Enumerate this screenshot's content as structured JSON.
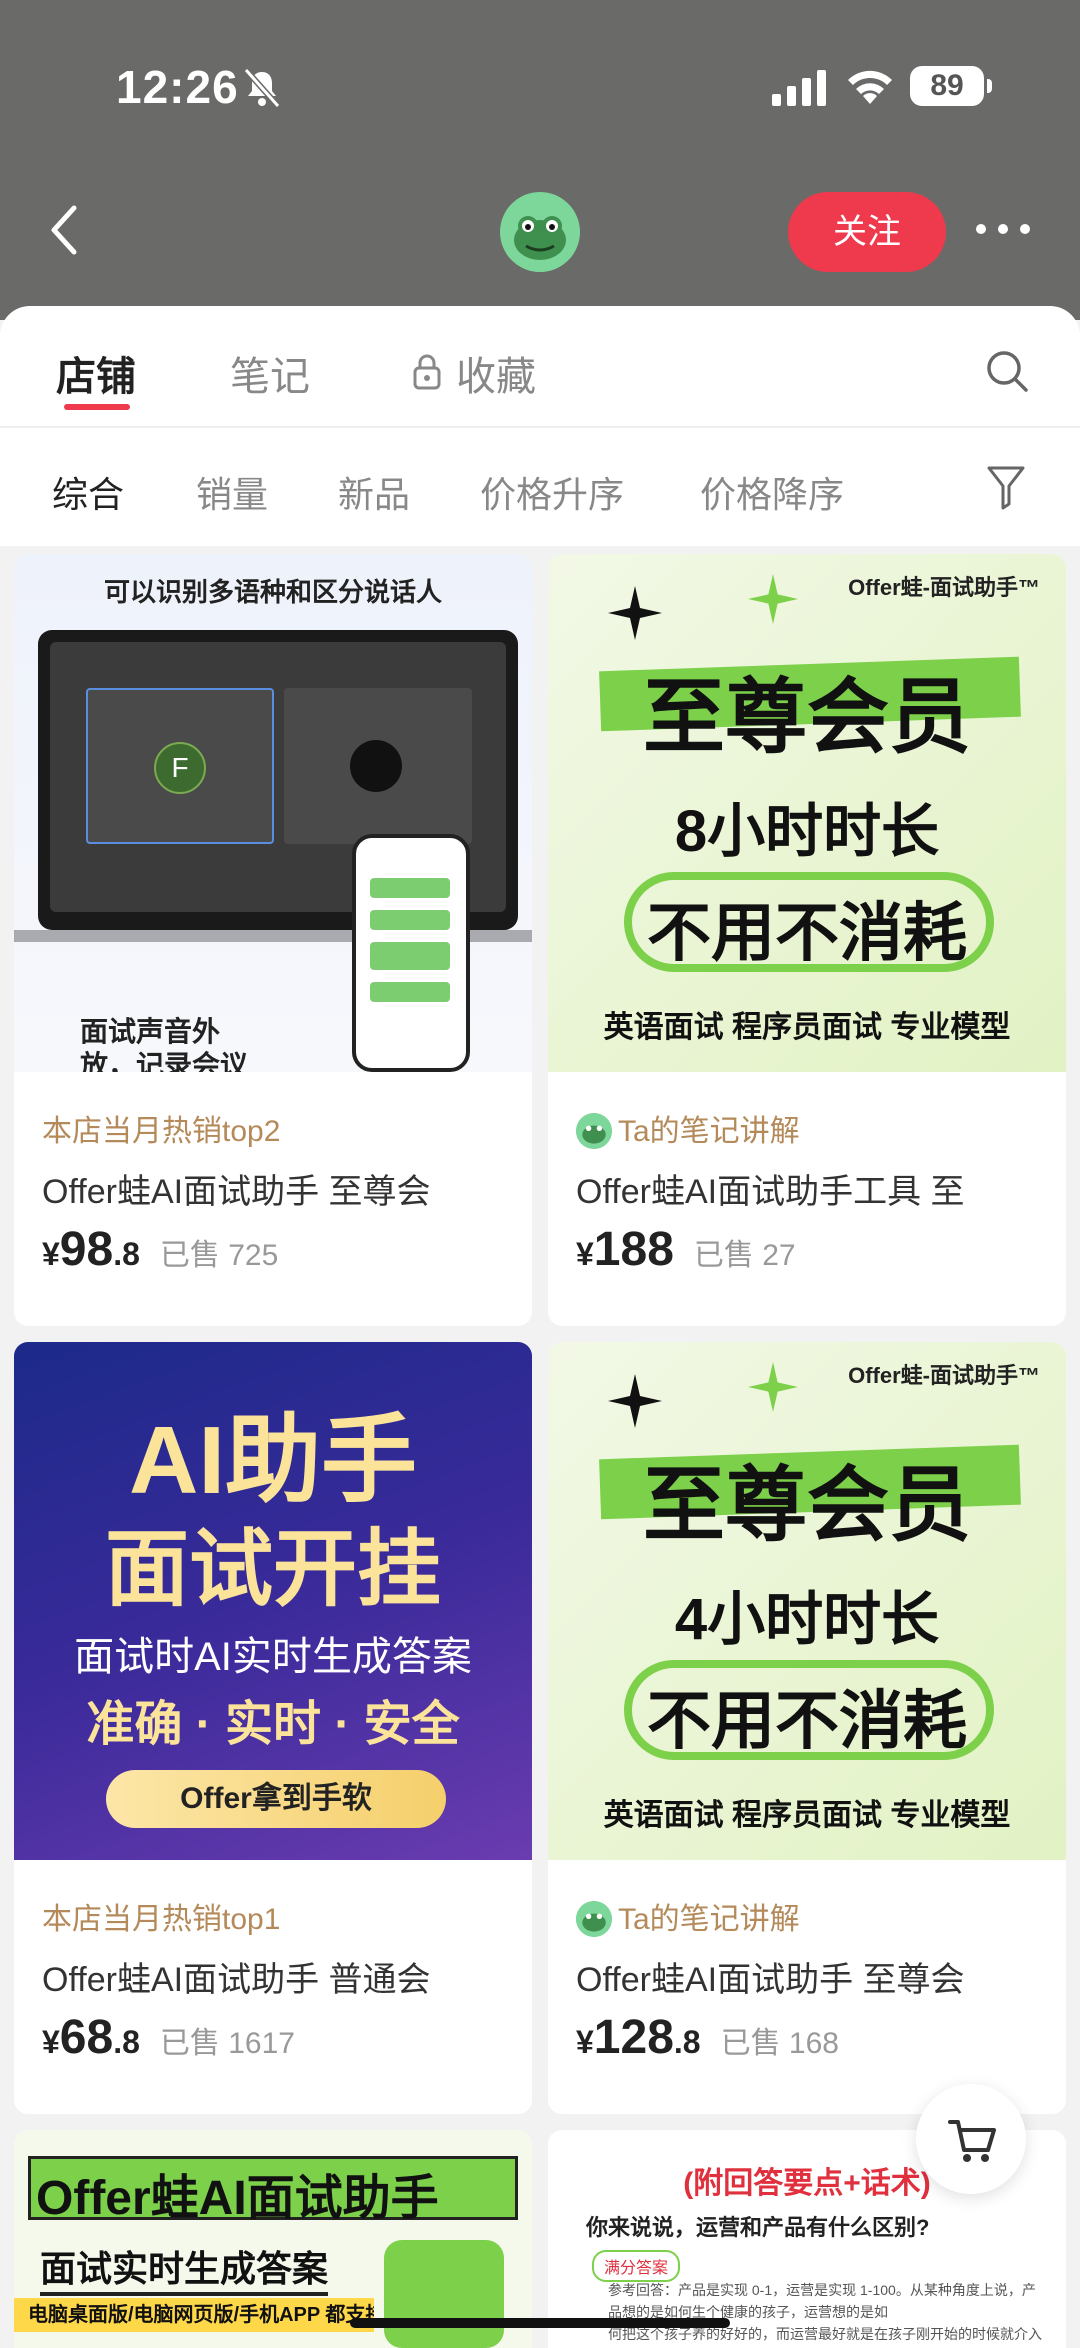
{
  "status_bar": {
    "time": "12:26",
    "battery": "89"
  },
  "header": {
    "follow_label": "关注"
  },
  "tabs": [
    {
      "label": "店铺"
    },
    {
      "label": "笔记"
    },
    {
      "label": "收藏"
    }
  ],
  "sort_options": [
    {
      "label": "综合"
    },
    {
      "label": "销量"
    },
    {
      "label": "新品"
    },
    {
      "label": "价格升序"
    },
    {
      "label": "价格降序"
    }
  ],
  "products": [
    {
      "tag": "本店当月热销top2",
      "title": "Offer蛙AI面试助手 至尊会",
      "currency": "¥",
      "price_int": "98",
      "price_dec": ".8",
      "sold": "已售 725",
      "image_text": {
        "headline": "可以识别多语种和区分说话人",
        "caption_line1": "面试声音外",
        "caption_line2": "放，记录会议",
        "avatar_letter": "F"
      }
    },
    {
      "tag": "Ta的笔记讲解",
      "title": "Offer蛙AI面试助手工具 至",
      "currency": "¥",
      "price_int": "188",
      "price_dec": "",
      "sold": "已售 27",
      "image_text": {
        "brand": "Offer蛙-面试助手™",
        "line1": "至尊会员",
        "line2": "8小时时长",
        "line3": "不用不消耗",
        "tags": "英语面试  程序员面试  专业模型"
      }
    },
    {
      "tag": "本店当月热销top1",
      "title": "Offer蛙AI面试助手 普通会",
      "currency": "¥",
      "price_int": "68",
      "price_dec": ".8",
      "sold": "已售 1617",
      "image_text": {
        "line1": "AI助手",
        "line2": "面试开挂",
        "line3": "面试时AI实时生成答案",
        "line4": "准确 · 实时 · 安全",
        "pill": "Offer拿到手软"
      }
    },
    {
      "tag": "Ta的笔记讲解",
      "title": "Offer蛙AI面试助手 至尊会",
      "currency": "¥",
      "price_int": "128",
      "price_dec": ".8",
      "sold": "已售 168",
      "image_text": {
        "brand": "Offer蛙-面试助手™",
        "line1": "至尊会员",
        "line2": "4小时时长",
        "line3": "不用不消耗",
        "tags": "英语面试  程序员面试  专业模型"
      }
    }
  ],
  "partial_products": [
    {
      "line1": "Offer蛙AI面试助手",
      "line2": "面试实时生成答案",
      "line3": "电脑桌面版/电脑网页版/手机APP 都支持！"
    },
    {
      "line1": "(附回答要点+话术)",
      "line2": "你来说说，运营和产品有什么区别?",
      "badge": "满分答案",
      "text1": "参考回答：产品是实现 0-1，运营是实现 1-100。从某种角度上说，产",
      "text2": "品想的是如何生个健康的孩子，运营想的是如",
      "text3": "何把这个孩子养的好好的，而运营最好就是在孩子刚开始的时候就介入"
    }
  ],
  "colors": {
    "accent": "#ef3a4d",
    "header_bg": "#6a6a69",
    "tag": "#b48a5a",
    "green": "#7cd04a"
  }
}
